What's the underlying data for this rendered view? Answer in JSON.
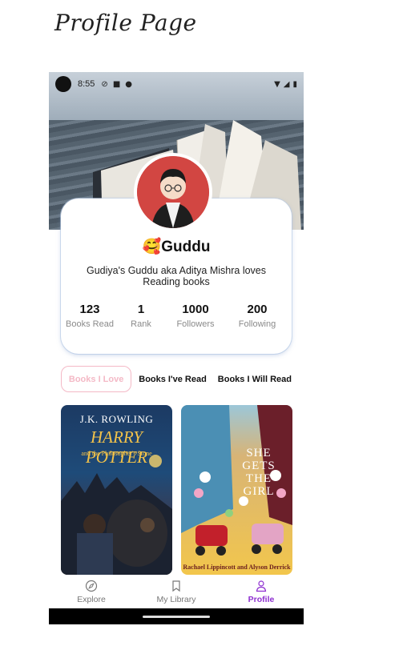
{
  "page_heading": "Profile Page",
  "status_bar": {
    "time": "8:55"
  },
  "profile": {
    "emoji": "🥰",
    "name": "Guddu",
    "bio": "Gudiya's Guddu aka Aditya Mishra loves Reading books"
  },
  "stats": [
    {
      "value": "123",
      "label": "Books Read"
    },
    {
      "value": "1",
      "label": "Rank"
    },
    {
      "value": "1000",
      "label": "Followers"
    },
    {
      "value": "200",
      "label": "Following"
    }
  ],
  "tabs": [
    {
      "label": "Books I Love",
      "active": true
    },
    {
      "label": "Books I've Read",
      "active": false
    },
    {
      "label": "Books I Will Read",
      "active": false
    }
  ],
  "books": [
    {
      "author": "J.K. ROWLING",
      "title": "HARRY POTTER",
      "subtitle": "and the Philosopher's Stone"
    },
    {
      "title": "SHE GETS THE GIRL",
      "authors": "Rachael Lippincott and Alyson Derrick"
    }
  ],
  "bottom_nav": [
    {
      "label": "Explore",
      "icon": "compass-icon",
      "active": false
    },
    {
      "label": "My Library",
      "icon": "bookmark-icon",
      "active": false
    },
    {
      "label": "Profile",
      "icon": "person-icon",
      "active": true
    }
  ],
  "colors": {
    "accent": "#8e2fd0",
    "tab_active": "#f4b9c6",
    "avatar_bg": "#d24642"
  }
}
